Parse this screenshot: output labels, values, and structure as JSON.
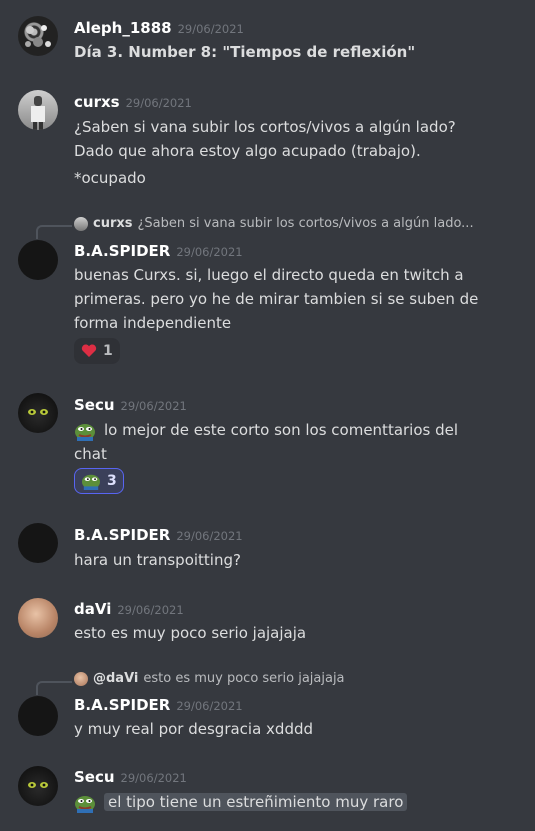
{
  "messages": [
    {
      "user": "Aleph_1888",
      "date": "29/06/2021",
      "lines": [
        "Día 3. Number 8: \"Tiempos de reflexión\""
      ]
    },
    {
      "user": "curxs",
      "date": "29/06/2021",
      "lines": [
        "¿Saben si vana subir los cortos/vivos a algún lado?",
        "Dado que ahora estoy algo acupado (trabajo).",
        "*ocupado"
      ]
    },
    {
      "reply_user": "curxs",
      "reply_text": "¿Saben si vana subir los cortos/vivos a algún lado...",
      "user": "B.A.SPIDER",
      "date": "29/06/2021",
      "lines": [
        "buenas Curxs. si, luego el directo queda en twitch a",
        "primeras. pero yo he de mirar tambien si se suben de",
        "forma independiente"
      ],
      "reaction": {
        "icon": "heart-icon",
        "count": "1"
      }
    },
    {
      "user": "Secu",
      "date": "29/06/2021",
      "lines": [
        "lo mejor de este corto son los comenttarios del",
        "chat"
      ],
      "reaction": {
        "icon": "pepe-emoji-icon",
        "count": "3"
      }
    },
    {
      "user": "B.A.SPIDER",
      "date": "29/06/2021",
      "lines": [
        "hara un transpoitting?"
      ]
    },
    {
      "user": "daVi",
      "date": "29/06/2021",
      "lines": [
        "esto es muy poco serio jajajaja"
      ]
    },
    {
      "reply_user": "@daVi",
      "reply_text": "esto es muy poco serio jajajaja",
      "user": "B.A.SPIDER",
      "date": "29/06/2021",
      "lines": [
        "y muy real por desgracia xdddd"
      ]
    },
    {
      "user": "Secu",
      "date": "29/06/2021",
      "lines": [
        "el tipo tiene un  estreñimiento muy raro"
      ]
    }
  ],
  "colors": {
    "background": "#36393f",
    "username": "#ffffff",
    "timestamp": "#72767d",
    "text": "#dcddde",
    "reaction_me": "#5865f2"
  }
}
